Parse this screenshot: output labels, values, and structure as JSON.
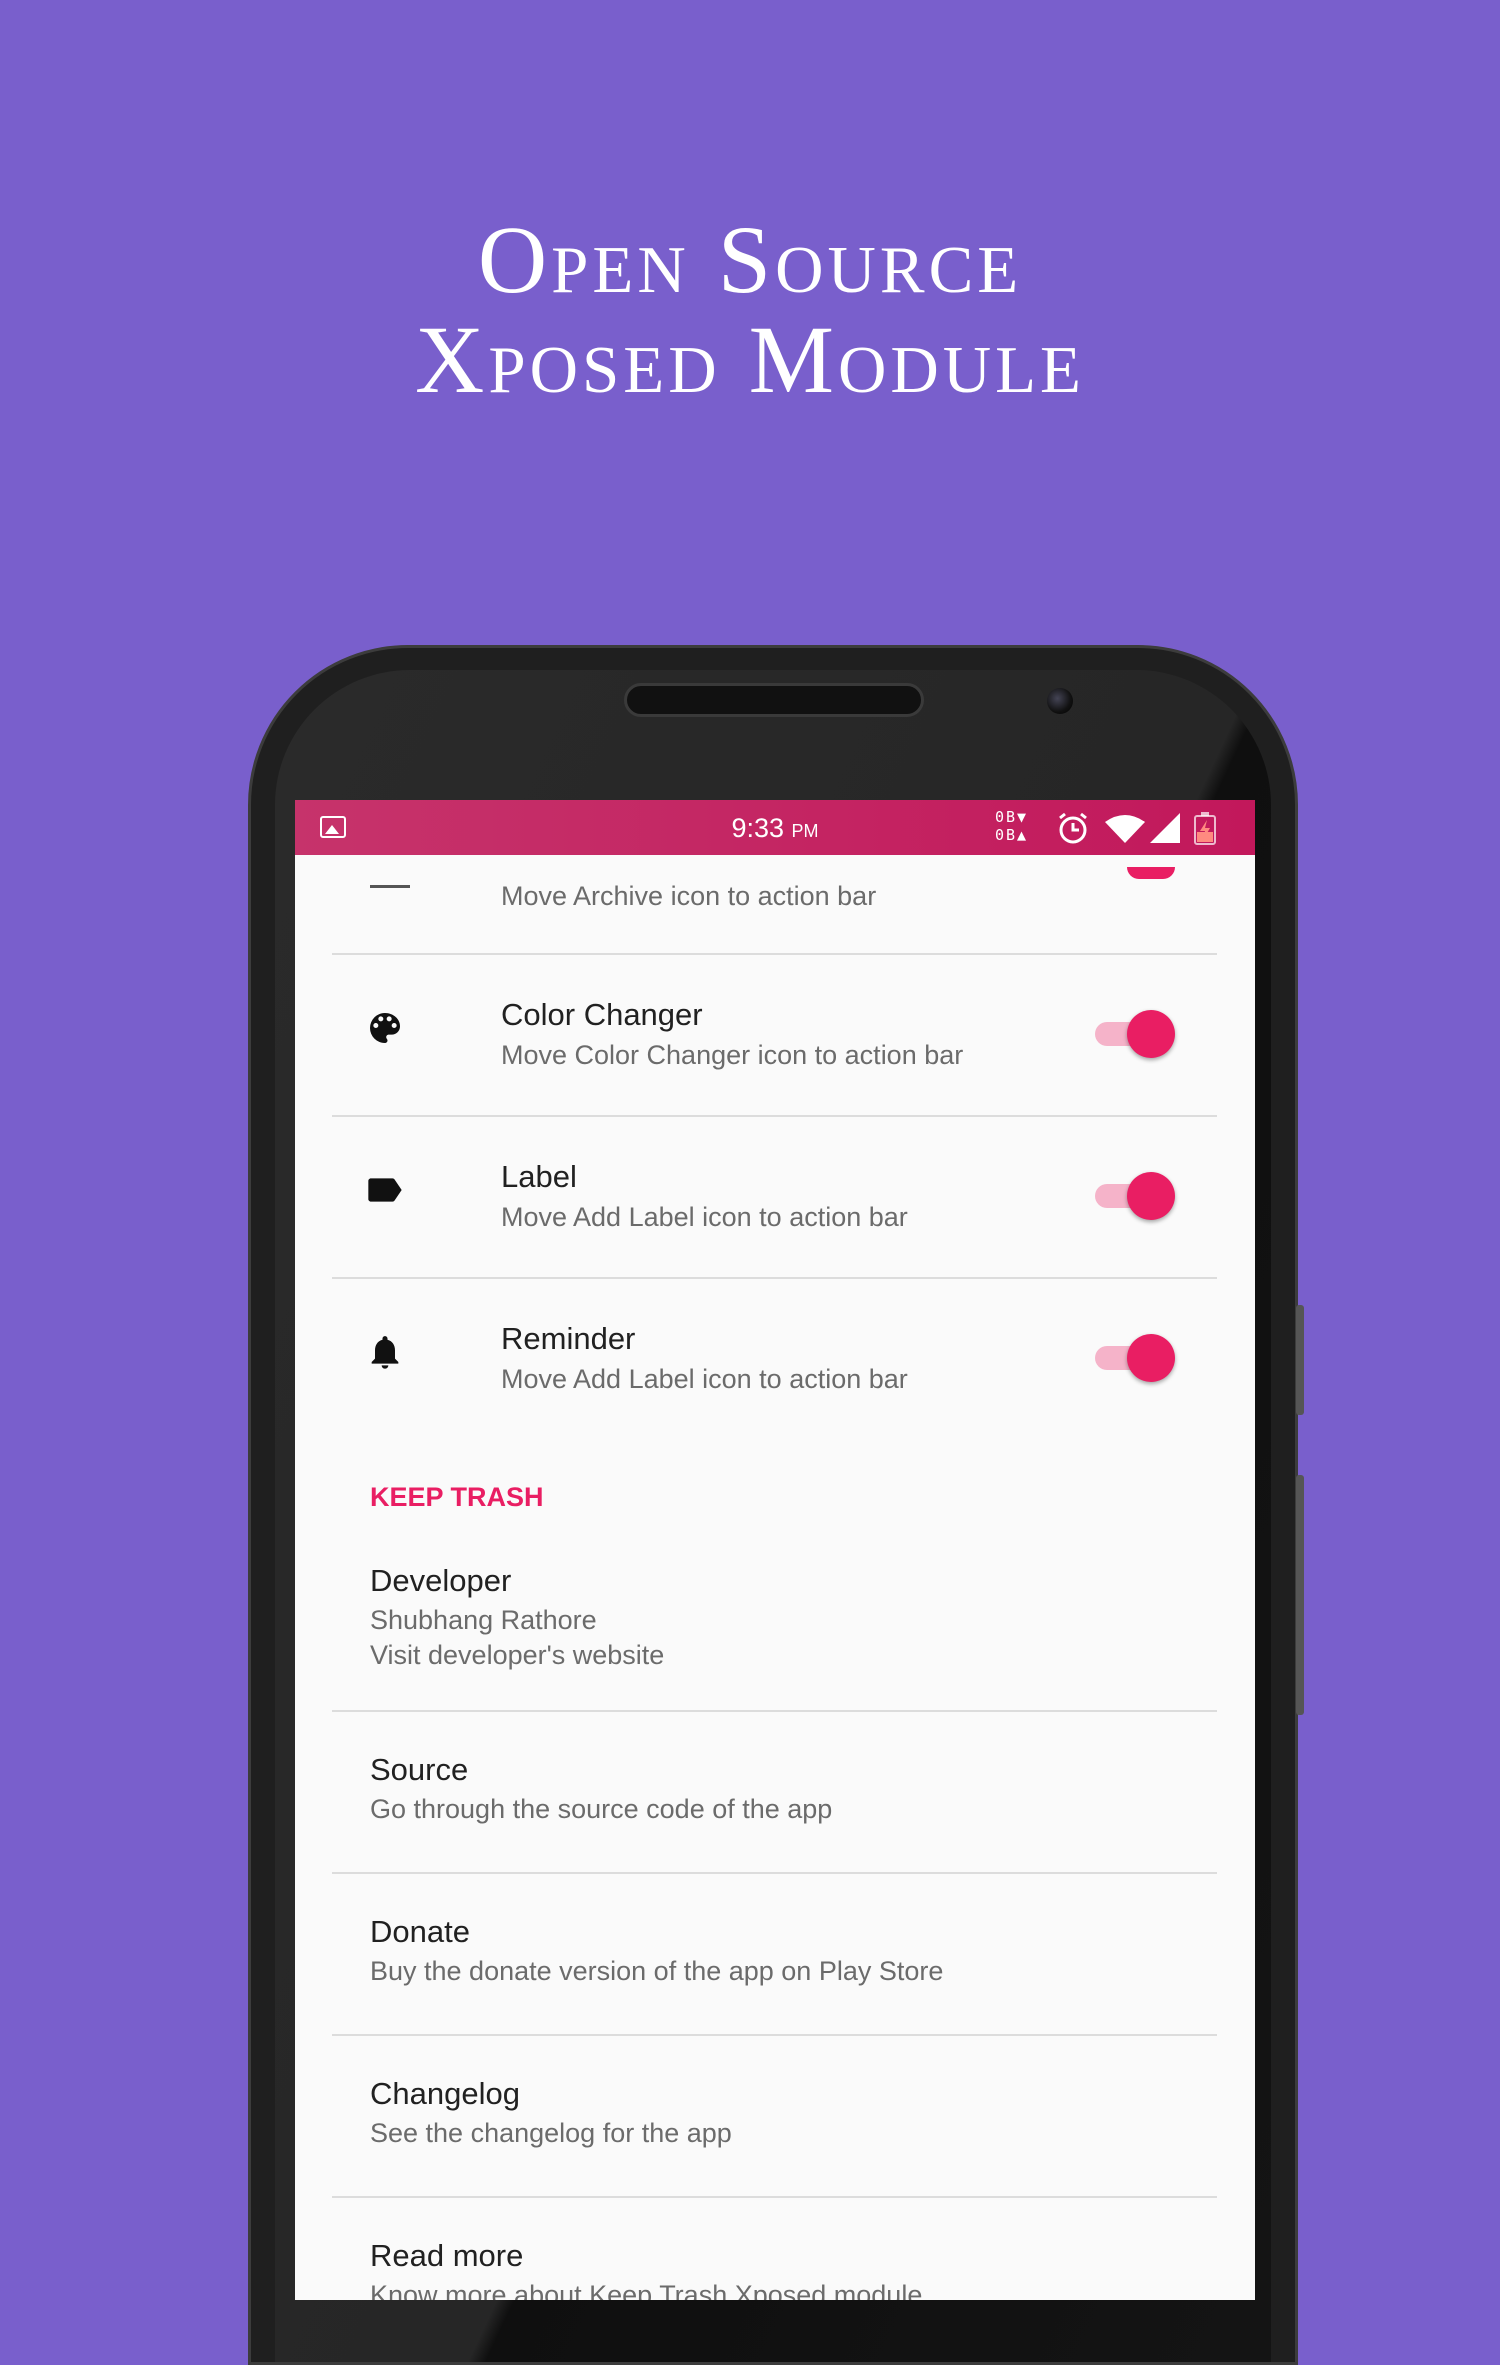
{
  "headline": {
    "line1": "Open Source",
    "line2": "Xposed Module"
  },
  "statusbar": {
    "time": "9:33",
    "ampm": "PM",
    "speed_down": "0B▼",
    "speed_up": "0B▲"
  },
  "toggles": [
    {
      "title": "",
      "subtitle": "Move Archive icon to action bar",
      "icon": "archive-icon",
      "on": true
    },
    {
      "title": "Color Changer",
      "subtitle": "Move Color Changer icon to action bar",
      "icon": "palette-icon",
      "on": true
    },
    {
      "title": "Label",
      "subtitle": "Move Add Label icon to action bar",
      "icon": "label-icon",
      "on": true
    },
    {
      "title": "Reminder",
      "subtitle": "Move Add Label icon to action bar",
      "icon": "bell-icon",
      "on": true
    }
  ],
  "section_header": "KEEP TRASH",
  "items": [
    {
      "title": "Developer",
      "subtitle": "Shubhang Rathore",
      "subtitle2": "Visit developer's website"
    },
    {
      "title": "Source",
      "subtitle": "Go through the source code of the app"
    },
    {
      "title": "Donate",
      "subtitle": "Buy the donate version of the app on Play Store"
    },
    {
      "title": "Changelog",
      "subtitle": "See the changelog for the app"
    },
    {
      "title": "Read more",
      "subtitle": "Know more about Keep Trash Xposed module"
    }
  ],
  "colors": {
    "background": "#795fcc",
    "accent": "#e91e63",
    "statusbar": "#c2185b"
  }
}
